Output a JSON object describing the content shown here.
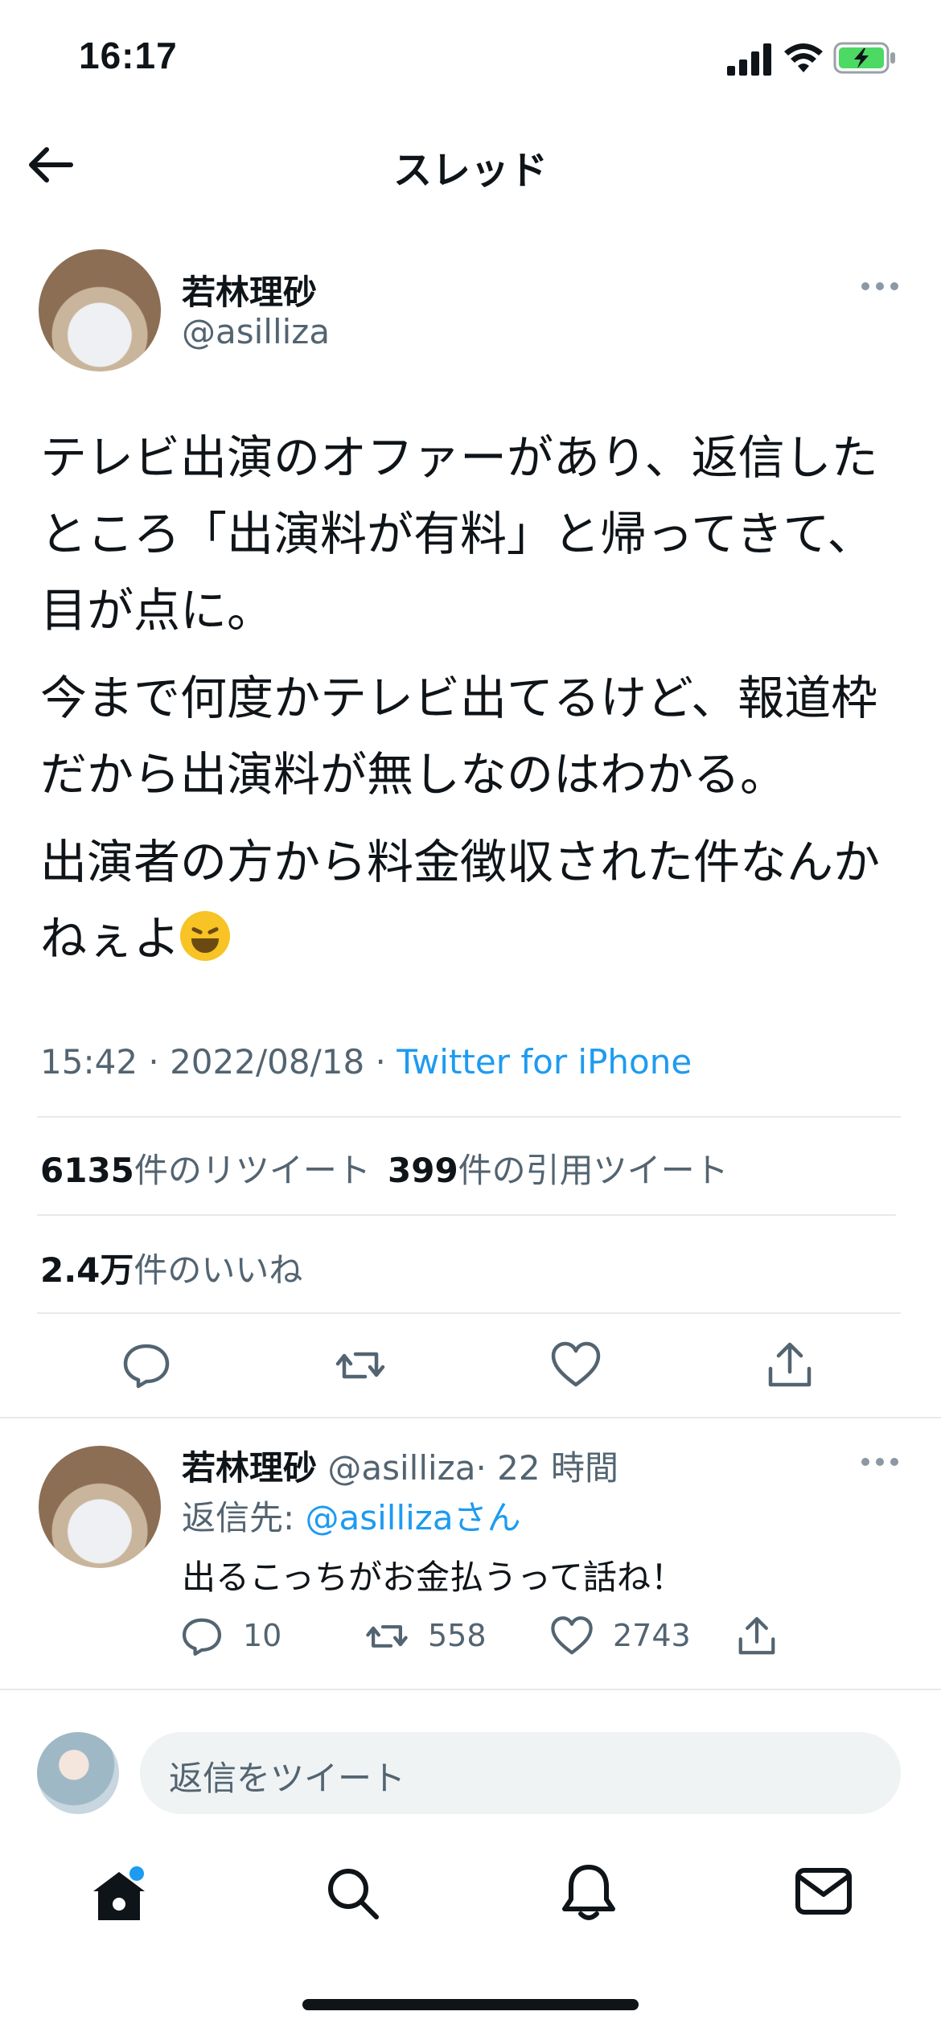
{
  "status_bar": {
    "time": "16:17"
  },
  "header": {
    "title": "スレッド"
  },
  "tweet": {
    "author_name": "若林理砂",
    "handle": "@asilliza",
    "paragraphs": [
      "テレビ出演のオファーがあり、返信したところ「出演料が有料」と帰ってきて、目が点に。",
      "今まで何度かテレビ出てるけど、報道枠だから出演料が無しなのはわかる。",
      "出演者の方から料金徴収された件なんかねぇよ"
    ],
    "emoji": "rolling-on-floor-laughing",
    "timestamp": "15:42 · 2022/08/18 · ",
    "source": "Twitter for iPhone",
    "stats": {
      "retweets_count": "6135",
      "retweets_label": "件のリツイート",
      "quotes_count": "399",
      "quotes_label": "件の引用ツイート",
      "likes_count": "2.4万",
      "likes_label": "件のいいね"
    }
  },
  "reply": {
    "author_name": "若林理砂",
    "handle": "@asilliza",
    "time": "· 22 時間",
    "reply_to_prefix": "返信先: ",
    "reply_to_handle": "@asilliza",
    "reply_to_suffix": "さん",
    "text": "出るこっちがお金払うって話ね！",
    "reply_count": "10",
    "retweet_count": "558",
    "like_count": "2743"
  },
  "composer": {
    "placeholder": "返信をツイート"
  },
  "tab_bar": {
    "items": [
      "home",
      "search",
      "notifications",
      "messages"
    ]
  },
  "colors": {
    "accent": "#1d9bf0",
    "muted": "#536471",
    "text": "#0f1419",
    "battery": "#4cd964"
  }
}
